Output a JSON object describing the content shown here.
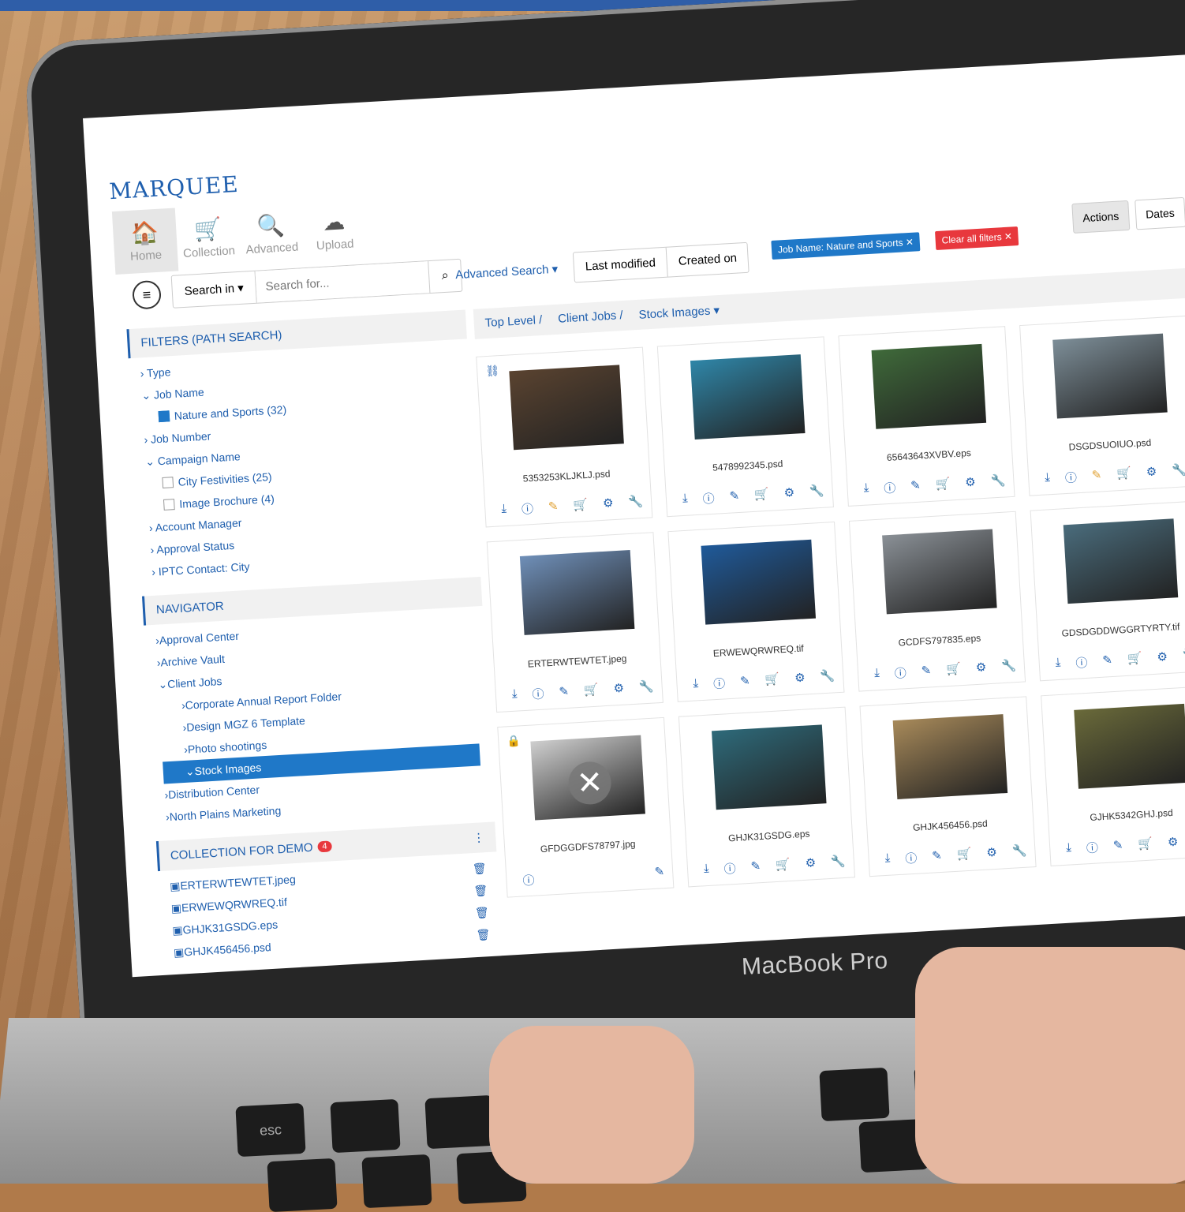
{
  "device": {
    "label": "MacBook Pro"
  },
  "app": {
    "logo": "MARQUEE"
  },
  "nav": [
    {
      "label": "Home",
      "icon": "home-icon",
      "glyph": "🏠"
    },
    {
      "label": "Collection",
      "icon": "cart-icon",
      "glyph": "🛒"
    },
    {
      "label": "Advanced",
      "icon": "search-icon",
      "glyph": "🔍"
    },
    {
      "label": "Upload",
      "icon": "cloud-upload-icon",
      "glyph": "☁"
    }
  ],
  "search": {
    "scope_label": "Search in ▾",
    "placeholder": "Search for...",
    "advanced_label": "Advanced Search ▾"
  },
  "sort": {
    "last_modified": "Last modified",
    "created_on": "Created on"
  },
  "filters_chips": {
    "job_chip": "Job Name: Nature and Sports ✕",
    "clear_chip": "Clear all filters ✕"
  },
  "right_buttons": {
    "actions": "Actions",
    "dates": "Dates"
  },
  "filters": {
    "title": "FILTERS (PATH SEARCH)",
    "rows": [
      {
        "label": "› Type"
      },
      {
        "label": "⌄ Job Name"
      },
      {
        "label": "Nature and Sports (32)"
      },
      {
        "label": "› Job Number"
      },
      {
        "label": "⌄ Campaign Name"
      },
      {
        "label": "City Festivities (25)"
      },
      {
        "label": "Image Brochure (4)"
      },
      {
        "label": "› Account Manager"
      },
      {
        "label": "› Approval Status"
      },
      {
        "label": "› IPTC Contact: City"
      }
    ]
  },
  "navigator": {
    "title": "NAVIGATOR",
    "rows": [
      {
        "label": "›Approval Center"
      },
      {
        "label": "›Archive Vault"
      },
      {
        "label": "⌄Client Jobs"
      },
      {
        "label": "›Corporate Annual Report Folder"
      },
      {
        "label": "›Design MGZ 6 Template"
      },
      {
        "label": "›Photo shootings"
      },
      {
        "label": "⌄Stock Images"
      },
      {
        "label": "›Distribution Center"
      },
      {
        "label": "›North Plains Marketing"
      }
    ]
  },
  "collection": {
    "title": "COLLECTION FOR DEMO",
    "count": "4",
    "items": [
      {
        "label": "ERTERWTEWTET.jpeg"
      },
      {
        "label": "ERWEWQRWREQ.tif"
      },
      {
        "label": "GHJK31GSDG.eps"
      },
      {
        "label": "GHJK456456.psd"
      }
    ]
  },
  "breadcrumb": {
    "top": "Top Level /",
    "client": "Client Jobs /",
    "stock": "Stock Images ▾"
  },
  "assets": [
    {
      "name": "5353253KLJKLJ.psd",
      "color": "#5a4330"
    },
    {
      "name": "5478992345.psd",
      "color": "#2f86a8"
    },
    {
      "name": "65643643XVBV.eps",
      "color": "#3f6a3a"
    },
    {
      "name": "DSGDSUOIUO.psd",
      "color": "#7d8e98"
    },
    {
      "name": "ERTERWTEWTET.jpeg",
      "color": "#6f8fb8"
    },
    {
      "name": "ERWEWQRWREQ.tif",
      "color": "#1f5a9a"
    },
    {
      "name": "GCDFS797835.eps",
      "color": "#8a9096"
    },
    {
      "name": "GDSDGDDWGGRTYRTY.tif",
      "color": "#4a6c7c"
    },
    {
      "name": "GFDGGDFS78797.jpg",
      "color": "#cfcfcf"
    },
    {
      "name": "GHJK31GSDG.eps",
      "color": "#2e6a7a"
    },
    {
      "name": "GHJK456456.psd",
      "color": "#a88a5a"
    },
    {
      "name": "GJHK5342GHJ.psd",
      "color": "#6a6a3a"
    }
  ]
}
